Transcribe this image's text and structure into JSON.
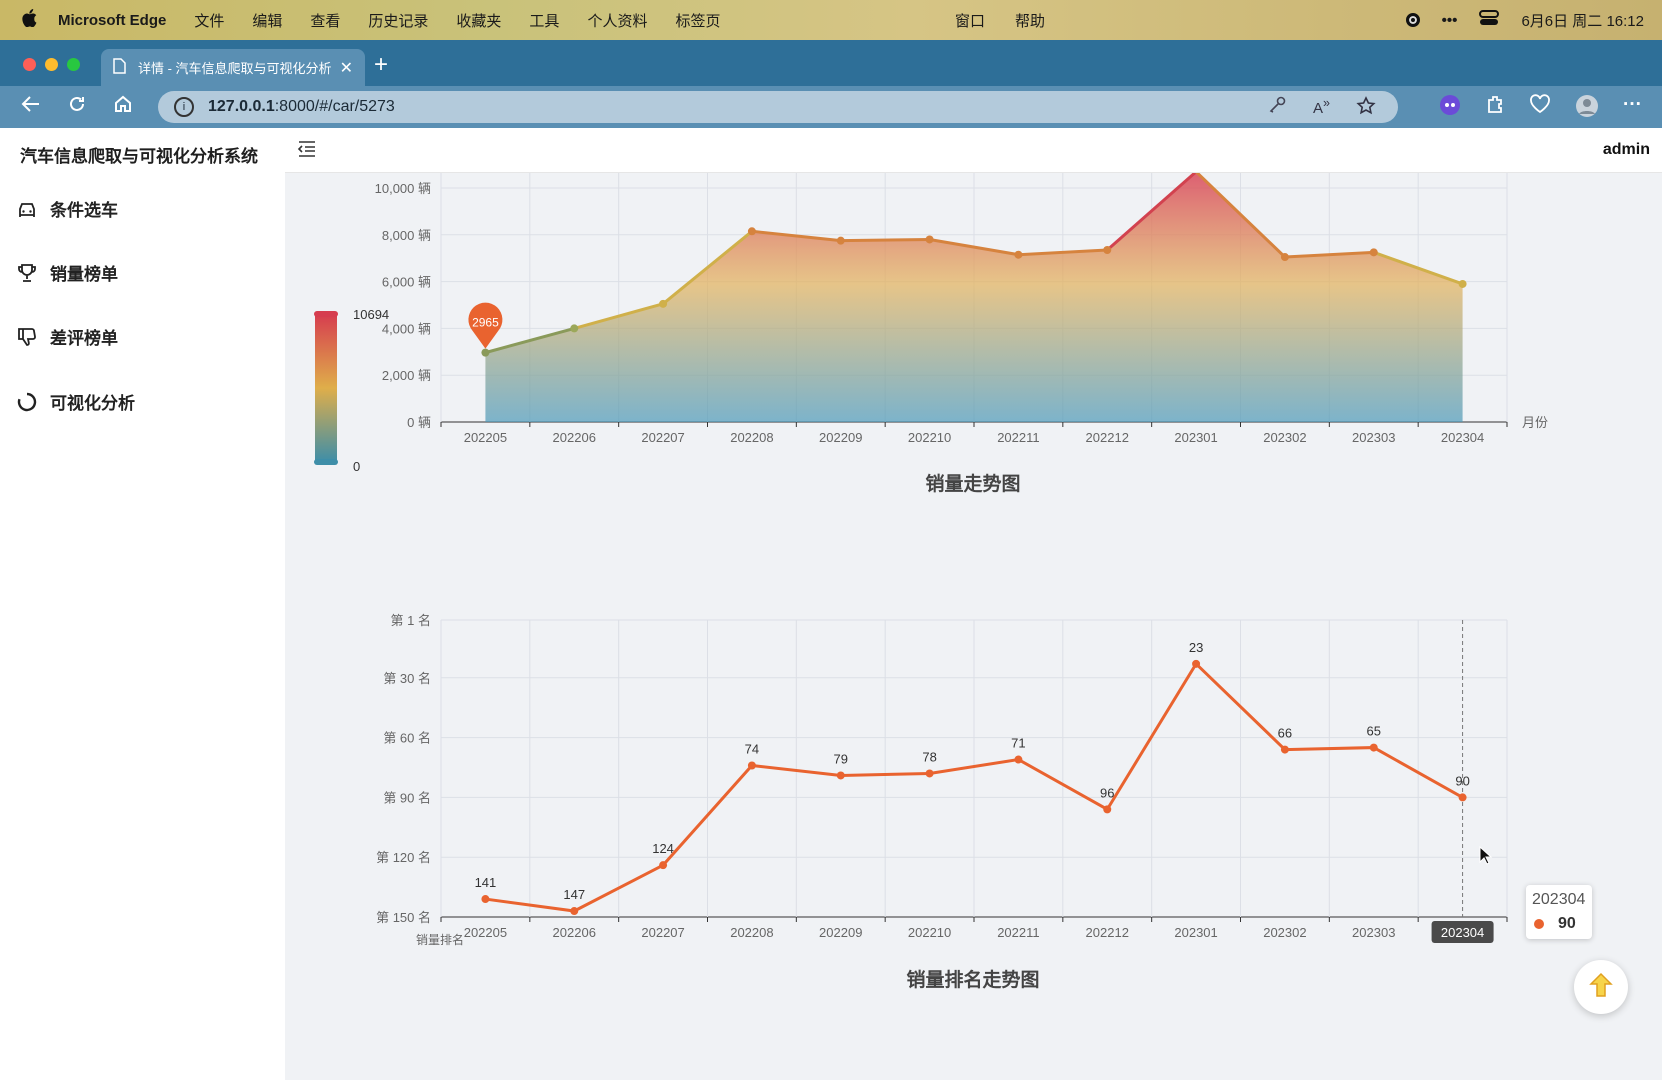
{
  "menubar": {
    "app_name": "Microsoft Edge",
    "items": [
      "文件",
      "编辑",
      "查看",
      "历史记录",
      "收藏夹",
      "工具",
      "个人资料",
      "标签页"
    ],
    "center_items": [
      "窗口",
      "帮助"
    ],
    "datetime": "6月6日 周二  16:12"
  },
  "browser": {
    "tab_title": "详情 - 汽车信息爬取与可视化分析",
    "url_host": "127.0.0.1",
    "url_rest": ":8000/#/car/5273"
  },
  "sidebar": {
    "brand": "汽车信息爬取与可视化分析系统",
    "items": [
      {
        "label": "条件选车",
        "icon": "car-icon"
      },
      {
        "label": "销量榜单",
        "icon": "trophy-icon"
      },
      {
        "label": "差评榜单",
        "icon": "thumbs-down-icon"
      },
      {
        "label": "可视化分析",
        "icon": "loading-ring-icon"
      }
    ]
  },
  "topbar": {
    "user": "admin"
  },
  "colors": {
    "accent": "#e9632f",
    "sidebar_bg": "#ffffff",
    "page_bg": "#f0f2f5"
  },
  "chart_data": [
    {
      "type": "area",
      "title": "销量走势图",
      "xlabel": "月份",
      "ylabel": "",
      "categories": [
        "202205",
        "202206",
        "202207",
        "202208",
        "202209",
        "202210",
        "202211",
        "202212",
        "202301",
        "202302",
        "202303",
        "202304"
      ],
      "values": [
        2965,
        4000,
        5050,
        8150,
        7750,
        7800,
        7150,
        7350,
        10694,
        7050,
        7250,
        5900
      ],
      "y_ticks": [
        "0 辆",
        "2,000 辆",
        "4,000 辆",
        "6,000 辆",
        "8,000 辆",
        "10,000 辆"
      ],
      "ylim": [
        0,
        10000
      ],
      "visual_map": {
        "min": 0,
        "max": 10694,
        "min_label": "0",
        "max_label": "10694"
      },
      "marker": {
        "category": "202205",
        "label": "2965"
      },
      "grid": true
    },
    {
      "type": "line",
      "title": "销量排名走势图",
      "xlabel": "销量排名",
      "categories": [
        "202205",
        "202206",
        "202207",
        "202208",
        "202209",
        "202210",
        "202211",
        "202212",
        "202301",
        "202302",
        "202303",
        "202304"
      ],
      "values": [
        141,
        147,
        124,
        74,
        79,
        78,
        71,
        96,
        23,
        66,
        65,
        90
      ],
      "y_ticks": [
        "第 1 名",
        "第 30 名",
        "第 60 名",
        "第 90 名",
        "第 120 名",
        "第 150 名"
      ],
      "ylim": [
        1,
        150
      ],
      "y_inverse": true,
      "grid": true,
      "highlight_category": "202304",
      "tooltip": {
        "category": "202304",
        "value": "90"
      }
    }
  ]
}
